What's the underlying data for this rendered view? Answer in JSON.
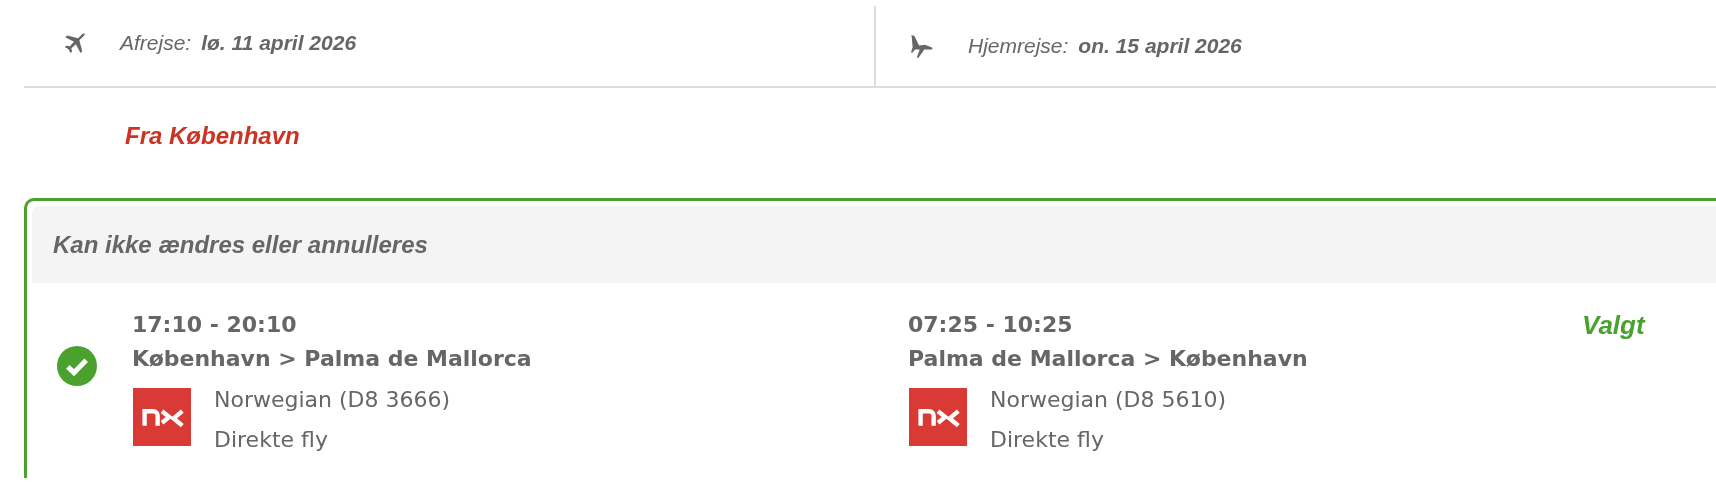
{
  "dates": [
    {
      "kind": "outbound",
      "label": "Afrejse:",
      "value": "lø. 11 april 2026"
    },
    {
      "kind": "return",
      "label": "Hjemrejse:",
      "value": "on. 15 april 2026"
    }
  ],
  "section_title": "Fra København",
  "option": {
    "note": "Kan ikke ændres eller annulleres",
    "selected": true,
    "status": "Valgt",
    "legs": [
      {
        "times": "17:10 - 20:10",
        "route": "København > Palma de Mallorca",
        "carrier": "Norwegian (D8 3666)",
        "type": "Direkte fly"
      },
      {
        "times": "07:25 - 10:25",
        "route": "Palma de Mallorca > København",
        "carrier": "Norwegian (D8 5610)",
        "type": "Direkte fly"
      }
    ]
  }
}
